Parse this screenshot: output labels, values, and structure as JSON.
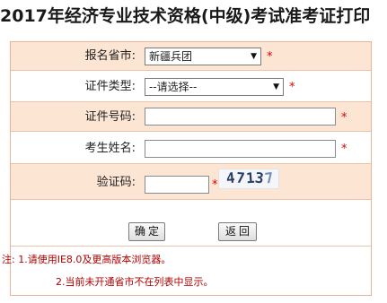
{
  "title": "2017年经济专业技术资格(中级)考试准考证打印",
  "fields": {
    "province": {
      "label": "报名省市:",
      "value": "新疆兵团"
    },
    "id_type": {
      "label": "证件类型:",
      "value": "--请选择--"
    },
    "id_number": {
      "label": "证件号码:",
      "value": ""
    },
    "name": {
      "label": "考生姓名:",
      "value": ""
    },
    "captcha": {
      "label": "验证码:",
      "value": "",
      "image_text": [
        "4",
        "7",
        "1",
        "3",
        "7"
      ]
    }
  },
  "required_mark": "*",
  "buttons": {
    "confirm": "确定",
    "back": "返回"
  },
  "notes": [
    "注: 1.请使用IE8.0及更高版本浏览器。",
    "2.当前未开通省市不在列表中显示。"
  ],
  "colors": {
    "row_shade": "#fde5d4",
    "border": "#e6b496",
    "required": "#e00000",
    "note": "#b00000"
  }
}
